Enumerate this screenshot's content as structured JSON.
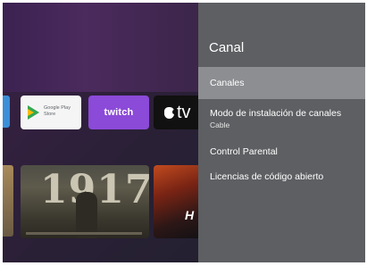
{
  "apps": [
    {
      "name": "Google Play Store",
      "line1": "Google Play",
      "line2": "Store"
    },
    {
      "name": "Twitch",
      "label": "twitch"
    },
    {
      "name": "Apple TV",
      "label": "tv"
    }
  ],
  "posters": [
    {
      "title": "1917"
    },
    {
      "title": "H"
    }
  ],
  "panel": {
    "title": "Canal",
    "items": [
      {
        "label": "Canales",
        "selected": true
      },
      {
        "label": "Modo de instalación de canales",
        "sub": "Cable"
      },
      {
        "label": "Control Parental"
      },
      {
        "label": "Licencias de código abierto"
      }
    ]
  },
  "colors": {
    "panel_bg": "#5d5f62",
    "selected_bg": "#8c8e91",
    "twitch": "#8b4ad8"
  }
}
